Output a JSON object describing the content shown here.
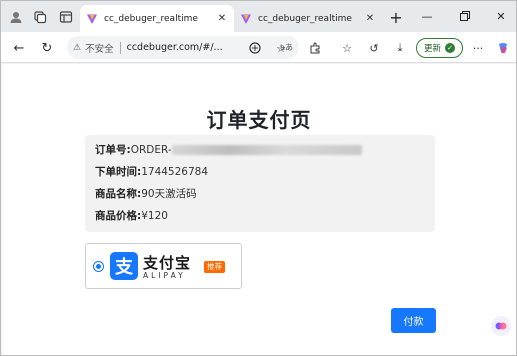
{
  "browser": {
    "tabs": [
      {
        "title": "cc_debuger_realtime",
        "active": true
      },
      {
        "title": "cc_debuger_realtime",
        "active": false
      }
    ],
    "new_tab": "+",
    "address": {
      "insecure_label": "不安全",
      "url": "ccdebuger.com/#/..."
    },
    "update_label": "更新"
  },
  "page": {
    "title": "订单支付页",
    "order": {
      "order_no_label": "订单号:",
      "order_no_value": "ORDER-",
      "order_time_label": "下单时间:",
      "order_time_value": "1744526784",
      "product_name_label": "商品名称:",
      "product_name_value": "90天激活码",
      "price_label": "商品价格:",
      "price_value": "¥120"
    },
    "payment": {
      "method_name": "支付宝",
      "method_name_en": "ALIPAY",
      "badge": "推荐",
      "selected": true
    },
    "pay_button": "付款"
  },
  "colors": {
    "accent": "#1677ff",
    "badge": "#ff6a00",
    "update_green": "#2e7d32"
  }
}
